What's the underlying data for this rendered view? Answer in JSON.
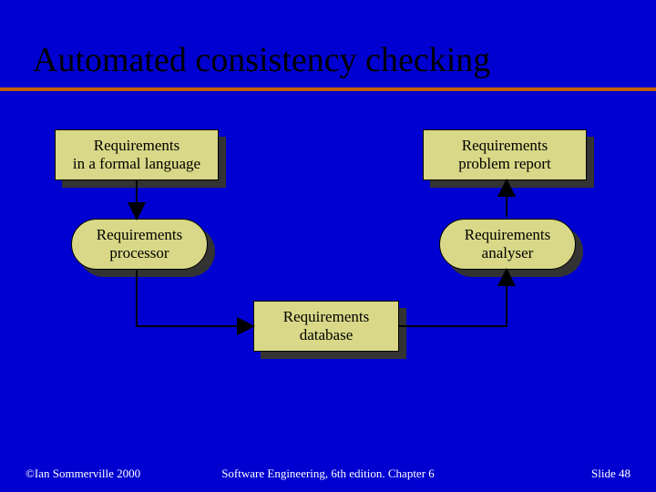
{
  "title": "Automated consistency checking",
  "boxes": {
    "req_formal": {
      "line1": "Requirements",
      "line2": "in a formal language"
    },
    "req_report": {
      "line1": "Requirements",
      "line2": "problem report"
    },
    "req_processor": {
      "line1": "Requirements",
      "line2": "processor"
    },
    "req_analyser": {
      "line1": "Requirements",
      "line2": "analyser"
    },
    "req_database": {
      "line1": "Requirements",
      "line2": "database"
    }
  },
  "footer": {
    "copyright": "©Ian Sommerville 2000",
    "center": "Software Engineering, 6th edition. Chapter 6",
    "slide_label": "Slide",
    "slide_number": "48"
  }
}
